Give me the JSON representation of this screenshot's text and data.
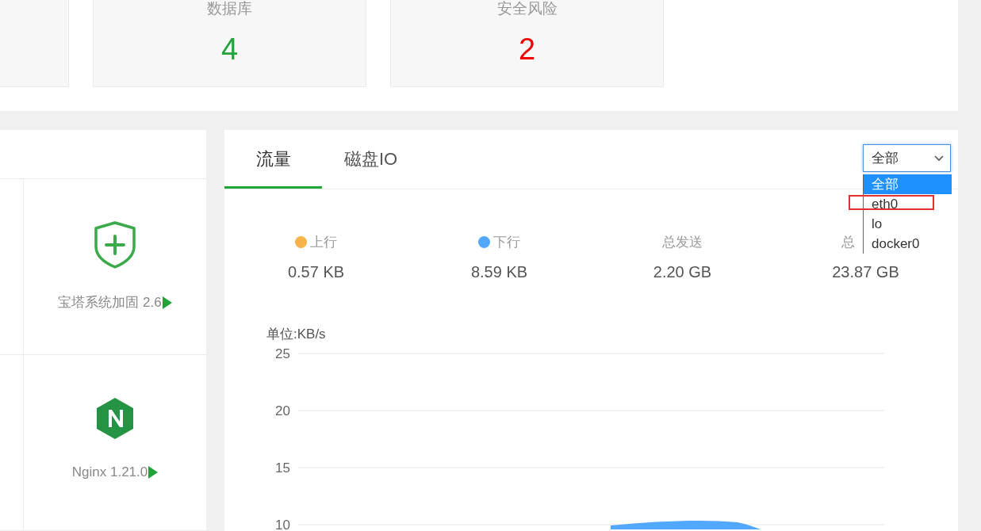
{
  "summary_cards": [
    {
      "label": "数据库",
      "value": "4",
      "color": "#20a53a"
    },
    {
      "label": "安全风险",
      "value": "2",
      "color": "#ee0000"
    }
  ],
  "software": [
    {
      "kind": "shield",
      "name": "宝塔系统加固 2.6"
    },
    {
      "kind": "nginx",
      "name": "Nginx 1.21.0"
    }
  ],
  "tabs": [
    {
      "label": "流量",
      "selected": true
    },
    {
      "label": "磁盘IO",
      "selected": false
    }
  ],
  "interface_select": {
    "value": "全部",
    "options": [
      {
        "label": "全部",
        "selected": true
      },
      {
        "label": "eth0",
        "selected": false,
        "highlighted_box": true
      },
      {
        "label": "lo",
        "selected": false
      },
      {
        "label": "docker0",
        "selected": false
      }
    ]
  },
  "stats": [
    {
      "label": "上行",
      "value": "0.57 KB",
      "color": "#f7b24a"
    },
    {
      "label": "下行",
      "value": "8.59 KB",
      "color": "#52a8ff"
    },
    {
      "label": "总发送",
      "value": "2.20 GB"
    },
    {
      "label": "总",
      "value": "23.87 GB"
    }
  ],
  "chart": {
    "unit": "单位:KB/s",
    "y_labels": [
      "25",
      "20",
      "15",
      "10"
    ]
  }
}
